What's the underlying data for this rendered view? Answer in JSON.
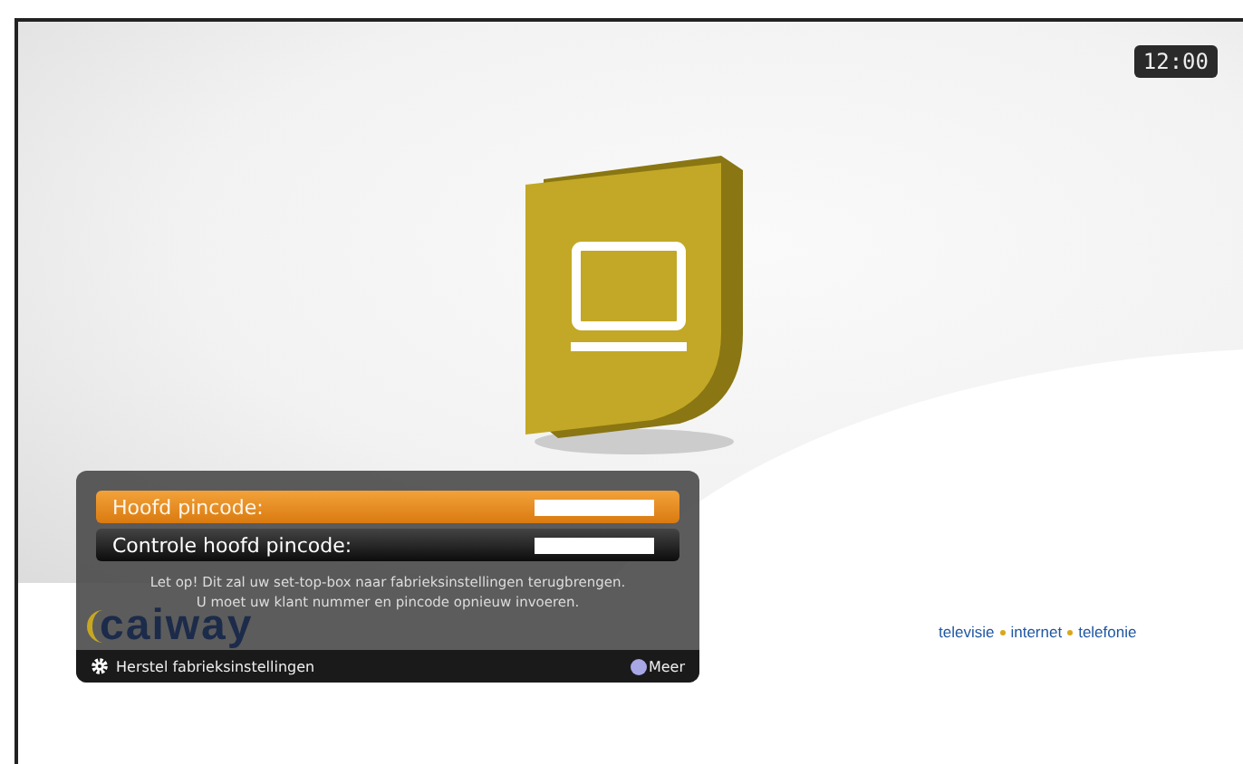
{
  "clock": "12:00",
  "logo": "caiway",
  "tagline": [
    "televisie",
    "internet",
    "telefonie"
  ],
  "dialog": {
    "fields": [
      {
        "label": "Hoofd pincode:",
        "selected": true
      },
      {
        "label": "Controle hoofd pincode:",
        "selected": false
      }
    ],
    "warning": [
      "Let op! Dit zal uw set-top-box naar fabrieksinstellingen terugbrengen.",
      "U moet uw klant nummer en pincode opnieuw invoeren."
    ],
    "footer_title": "Herstel fabrieksinstellingen",
    "more": "Meer"
  }
}
